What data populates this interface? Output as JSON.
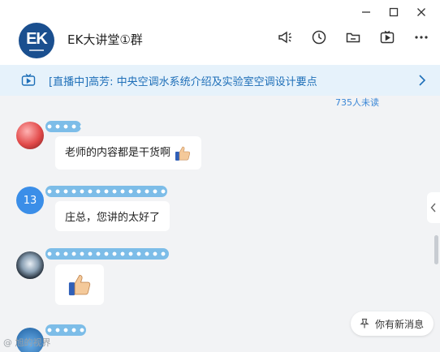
{
  "window": {
    "controls": [
      {
        "name": "minimize",
        "glyph": "—"
      },
      {
        "name": "maximize",
        "glyph": "☐"
      },
      {
        "name": "close",
        "glyph": "✕"
      }
    ]
  },
  "header": {
    "logo_text": "EK",
    "title": "EK大讲堂①群",
    "toolbar": [
      {
        "name": "announcement-icon"
      },
      {
        "name": "history-clock-icon"
      },
      {
        "name": "folder-icon"
      },
      {
        "name": "video-icon"
      },
      {
        "name": "more-icon"
      }
    ]
  },
  "banner": {
    "icon": "tv-live-icon",
    "text": "[直播中]高芳: 中央空调水系统介绍及实验室空调设计要点",
    "color": "#1e6fb8"
  },
  "unread_count": "735人未读",
  "messages": [
    {
      "avatar": "red-avatar",
      "text": "老师的内容都是干货啊",
      "has_thumb": true
    },
    {
      "avatar_text": "13",
      "text": "庄总，您讲的太好了",
      "has_thumb": false
    },
    {
      "avatar": "dark-avatar",
      "text": "",
      "has_thumb": true
    },
    {
      "avatar": "photo-avatar"
    }
  ],
  "new_message_pill": "你有新消息",
  "watermark": "@ 旭的视界",
  "colors": {
    "accent": "#3b87d6",
    "background": "#f2f3f5",
    "banner_bg": "#e6f2fb"
  }
}
